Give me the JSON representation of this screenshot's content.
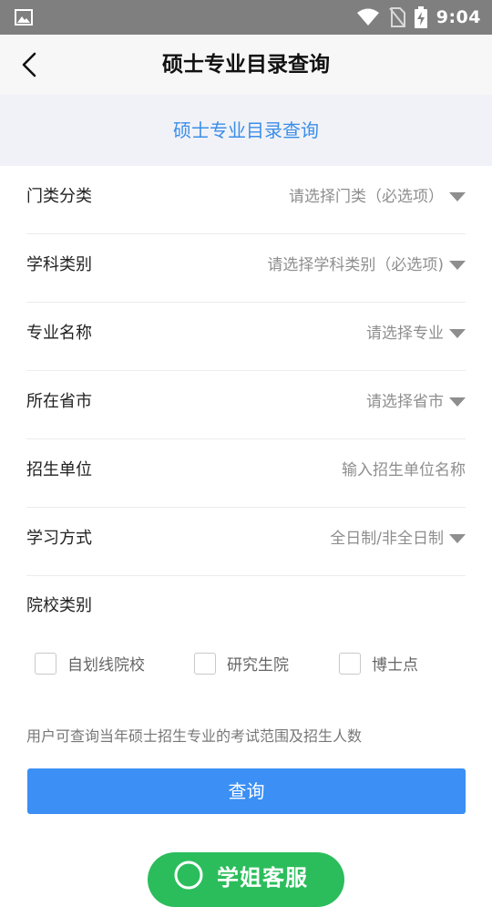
{
  "status_bar": {
    "time": "9:04",
    "icons": [
      "image-icon",
      "wifi-icon",
      "no-sim-icon",
      "battery-charging-icon"
    ]
  },
  "header": {
    "title": "硕士专业目录查询",
    "back_icon": "chevron-left-icon"
  },
  "banner": {
    "text": "硕士专业目录查询"
  },
  "form": {
    "rows": [
      {
        "label": "门类分类",
        "value": "请选择门类（必选项）",
        "has_dropdown": true
      },
      {
        "label": "学科类别",
        "value": "请选择学科类别（必选项)",
        "has_dropdown": true
      },
      {
        "label": "专业名称",
        "value": "请选择专业",
        "has_dropdown": true
      },
      {
        "label": "所在省市",
        "value": "请选择省市",
        "has_dropdown": true
      },
      {
        "label": "招生单位",
        "value": "输入招生单位名称",
        "has_dropdown": false
      },
      {
        "label": "学习方式",
        "value": "全日制/非全日制",
        "has_dropdown": true
      }
    ],
    "school_type_label": "院校类别",
    "checkboxes": [
      {
        "label": "自划线院校",
        "checked": false
      },
      {
        "label": "研究生院",
        "checked": false
      },
      {
        "label": "博士点",
        "checked": false
      }
    ]
  },
  "note": "用户可查询当年硕士招生专业的考试范围及招生人数",
  "query_button": "查询",
  "service_button": "学姐客服",
  "colors": {
    "accent_blue": "#3b8ff5",
    "banner_text": "#3b8ee8",
    "service_green": "#2bbd5b",
    "status_bar": "#7f7f7f"
  }
}
